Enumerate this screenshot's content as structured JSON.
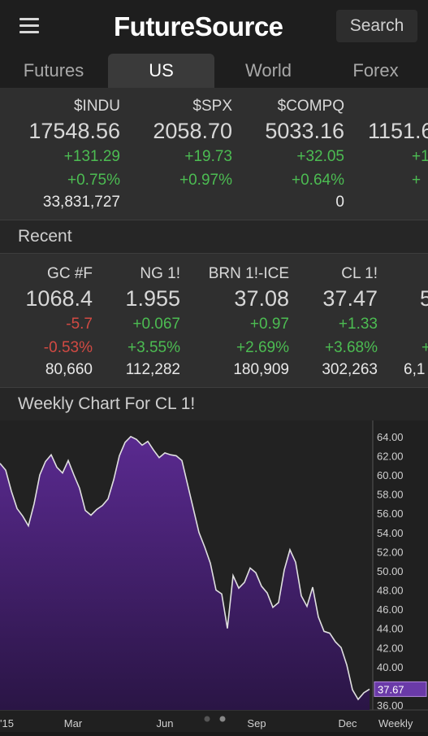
{
  "header": {
    "brand": "FutureSource",
    "search_label": "Search"
  },
  "tabs": [
    {
      "label": "Futures",
      "active": false
    },
    {
      "label": "US",
      "active": true
    },
    {
      "label": "World",
      "active": false
    },
    {
      "label": "Forex",
      "active": false
    }
  ],
  "us_quotes": [
    {
      "symbol": "$INDU",
      "last": "17548.56",
      "change": "+131.29",
      "pct": "+0.75%",
      "volume": "33,831,727",
      "dir": "pos"
    },
    {
      "symbol": "$SPX",
      "last": "2058.70",
      "change": "+19.73",
      "pct": "+0.97%",
      "volume": "",
      "dir": "pos"
    },
    {
      "symbol": "$COMPQ",
      "last": "5033.16",
      "change": "+32.05",
      "pct": "+0.64%",
      "volume": "0",
      "dir": "pos"
    },
    {
      "symbol": "",
      "last": "1151.6",
      "change": "+1",
      "pct": "+",
      "volume": "",
      "dir": "pos"
    }
  ],
  "recent": {
    "title": "Recent",
    "quotes": [
      {
        "symbol": "GC #F",
        "last": "1068.4",
        "change": "-5.7",
        "pct": "-0.53%",
        "volume": "80,660",
        "dir": "neg"
      },
      {
        "symbol": "NG 1!",
        "last": "1.955",
        "change": "+0.067",
        "pct": "+3.55%",
        "volume": "112,282",
        "dir": "pos"
      },
      {
        "symbol": "BRN 1!-ICE",
        "last": "37.08",
        "change": "+0.97",
        "pct": "+2.69%",
        "volume": "180,909",
        "dir": "pos"
      },
      {
        "symbol": "CL 1!",
        "last": "37.47",
        "change": "+1.33",
        "pct": "+3.68%",
        "volume": "302,263",
        "dir": "pos"
      },
      {
        "symbol": "",
        "last": "5",
        "change": "",
        "pct": "+",
        "volume": "6,1",
        "dir": "pos"
      }
    ]
  },
  "chart_section": {
    "title": "Weekly Chart For CL 1!"
  },
  "chart_data": {
    "type": "area",
    "title": "",
    "xlabel": "",
    "ylabel": "",
    "x_tick_labels": [
      "'15",
      "Mar",
      "Jun",
      "Sep",
      "Dec"
    ],
    "period_label": "Weekly",
    "y_ticks": [
      "36.00",
      "38.00",
      "40.00",
      "42.00",
      "44.00",
      "46.00",
      "48.00",
      "50.00",
      "52.00",
      "54.00",
      "56.00",
      "58.00",
      "60.00",
      "62.00",
      "64.00"
    ],
    "ylim": [
      35.5,
      65
    ],
    "last_value_label": "37.67",
    "week_index_range": [
      0,
      50
    ],
    "series": [
      {
        "values": [
          61.2,
          60.5,
          58.3,
          56.5,
          55.7,
          54.7,
          57.0,
          60.0,
          61.4,
          62.1,
          60.8,
          60.2,
          61.5,
          60.0,
          58.6,
          56.3,
          55.8,
          56.4,
          56.8,
          57.5,
          59.5,
          62.0,
          63.4,
          64.0,
          63.7,
          63.1,
          63.5,
          62.6,
          61.8,
          62.3,
          62.1,
          62.0,
          61.5,
          59.0,
          56.5,
          54.0,
          52.5,
          50.8,
          48.0,
          47.6,
          44.0,
          49.5,
          48.2,
          48.8,
          50.3,
          49.8,
          48.4,
          47.7,
          46.2,
          46.7,
          50.1,
          52.2,
          50.9,
          47.4,
          46.3,
          48.3,
          45.2,
          43.7,
          43.5,
          42.6,
          42.0,
          40.2,
          37.6,
          36.6,
          37.3,
          37.67
        ]
      }
    ],
    "fill_color": "#4a2278",
    "line_color": "#e0e0e0",
    "last_label_color": "#6a3aa8"
  }
}
